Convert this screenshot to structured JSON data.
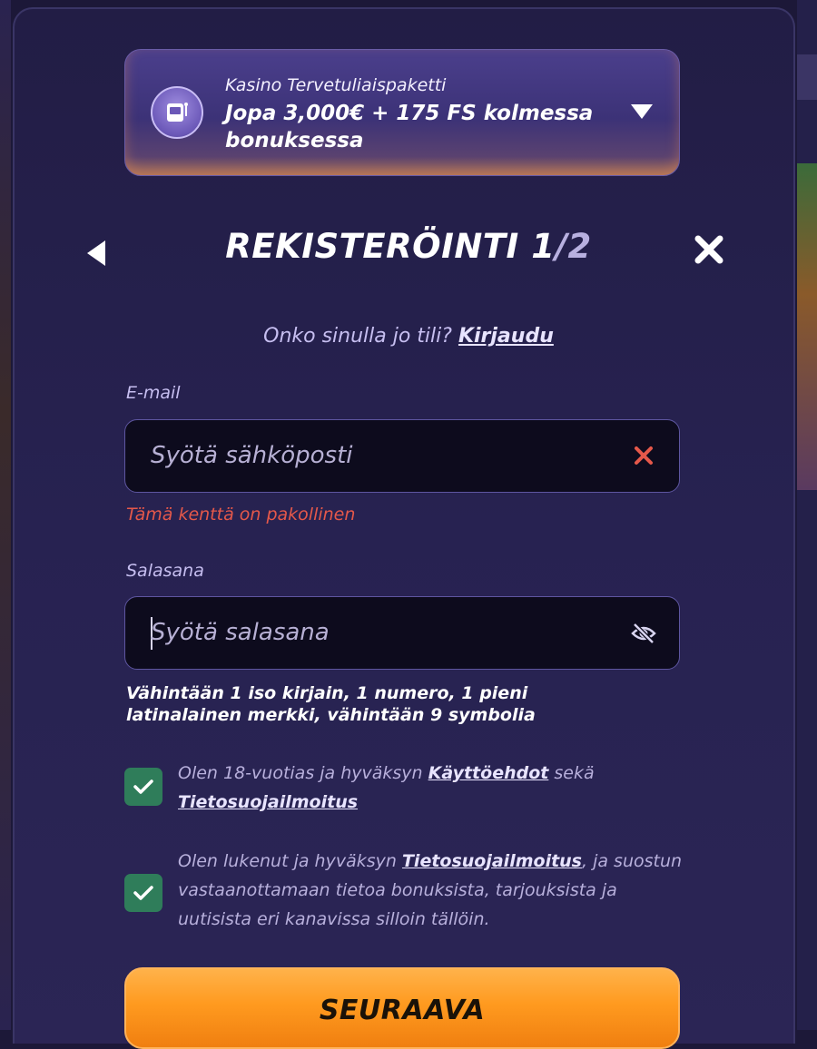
{
  "promo": {
    "subtitle": "Kasino Tervetuliaispaketti",
    "title": "Jopa 3,000€ + 175 FS kolmessa bonuksessa",
    "icon": "slot-machine-icon"
  },
  "header": {
    "title": "REKISTERÖINTI 1",
    "step": "/2",
    "back_icon": "back-arrow-icon",
    "close_icon": "close-icon"
  },
  "login_prompt": {
    "text": "Onko sinulla jo tili?",
    "link": "Kirjaudu"
  },
  "email": {
    "label": "E-mail",
    "placeholder": "Syötä sähköposti",
    "error": "Tämä kenttä on pakollinen",
    "error_color": "#e5584a"
  },
  "password": {
    "label": "Salasana",
    "placeholder": "Syötä salasana",
    "hint": "Vähintään 1 iso kirjain, 1 numero, 1 pieni latinalainen merkki, vähintään 9 symbolia"
  },
  "consents": [
    {
      "checked": true,
      "text_before": "Olen 18-vuotias ja hyväksyn ",
      "link1": "Käyttöehdot",
      "text_middle": " sekä ",
      "link2": "Tietosuojailmoitus"
    },
    {
      "checked": true,
      "text_before": "Olen lukenut ja hyväksyn ",
      "link1": "Tietosuojailmoitus",
      "text_after": ", ja suostun vastaanottamaan tietoa bonuksista, tarjouksista ja uutisista eri kanavissa silloin tällöin."
    }
  ],
  "next_button": {
    "label": "SEURAAVA"
  },
  "colors": {
    "accent": "#ff9a1f",
    "checkbox": "#2f7d5a",
    "background": "#221d45"
  }
}
